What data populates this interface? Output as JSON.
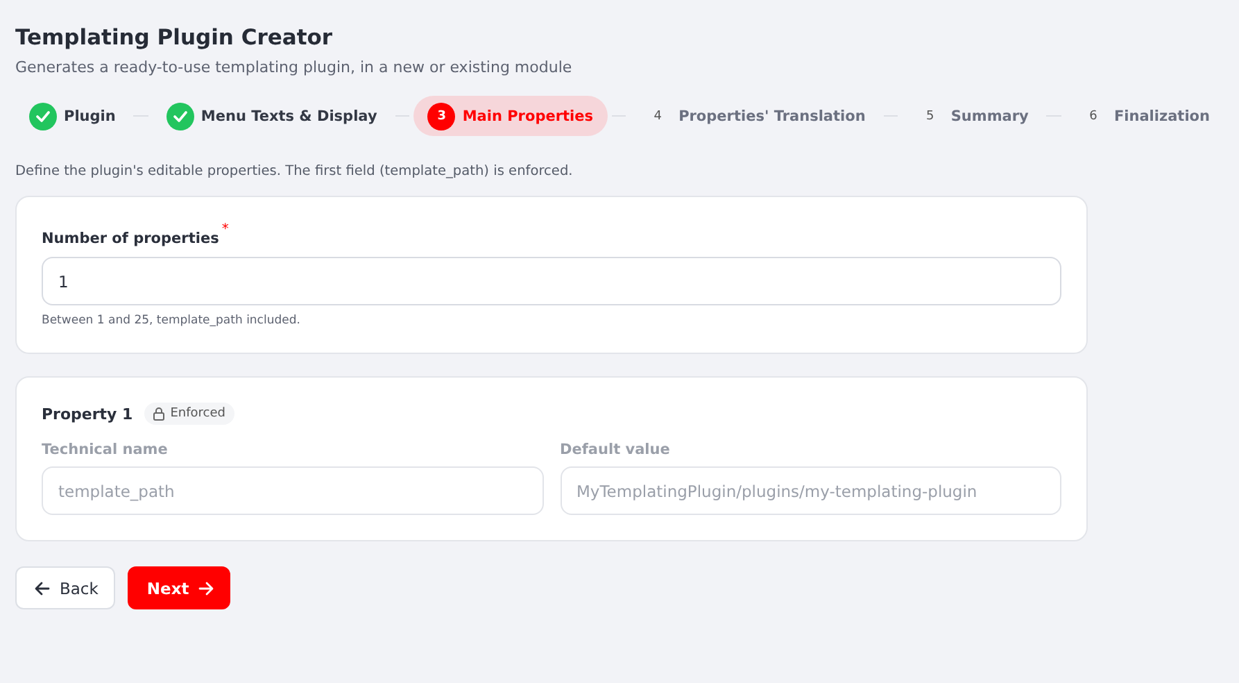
{
  "header": {
    "title": "Templating Plugin Creator",
    "subtitle": "Generates a ready-to-use templating plugin, in a new or existing module"
  },
  "steps": [
    {
      "label": "Plugin",
      "completed": true,
      "selected": false
    },
    {
      "label": "Menu Texts & Display",
      "completed": true,
      "selected": false
    },
    {
      "number": "3",
      "label": "Main Properties",
      "completed": false,
      "selected": true
    },
    {
      "number": "4",
      "label": "Properties' Translation",
      "completed": false,
      "selected": false
    },
    {
      "number": "5",
      "label": "Summary",
      "completed": false,
      "selected": false
    },
    {
      "number": "6",
      "label": "Finalization",
      "completed": false,
      "selected": false
    }
  ],
  "intro": "Define the plugin's editable properties. The first field (template_path) is enforced.",
  "count_card": {
    "label": "Number of properties",
    "required_mark": "*",
    "value": "1",
    "hint": "Between 1 and 25, template_path included."
  },
  "property_card": {
    "title": "Property 1",
    "badge": "Enforced",
    "fields": [
      {
        "label": "Technical name",
        "value": "template_path",
        "disabled": true
      },
      {
        "label": "Default value",
        "value": "MyTemplatingPlugin/plugins/my-templating-plugin",
        "disabled": true
      }
    ]
  },
  "buttons": [
    {
      "label": "Back",
      "kind": "secondary"
    },
    {
      "label": "Next",
      "kind": "primary"
    }
  ]
}
